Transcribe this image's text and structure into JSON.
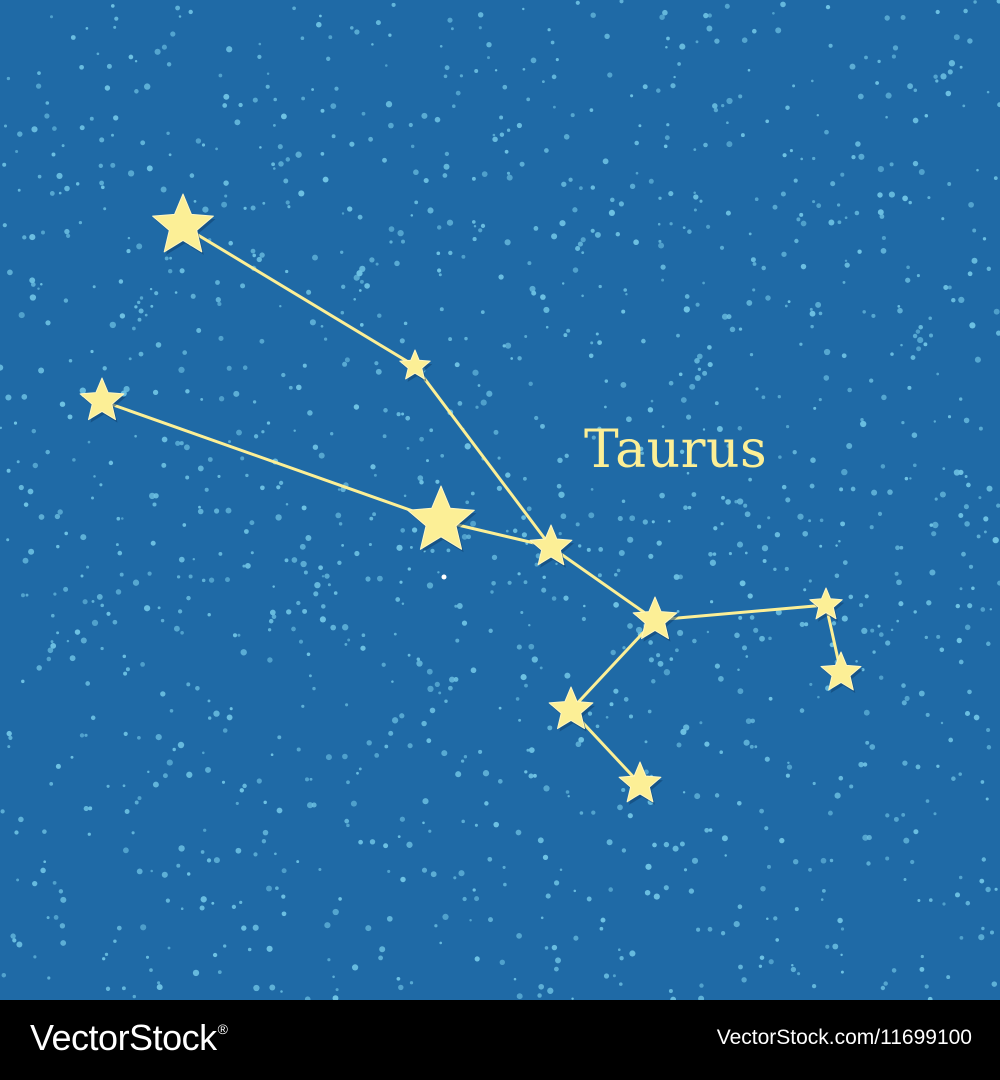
{
  "title": "Taurus",
  "colors": {
    "sky": "#1f6aa6",
    "dust": "#6ec2e3",
    "star": "#fcef96",
    "line": "#fcef96",
    "footer": "#000000"
  },
  "watermark": {
    "brand": "VectorStock",
    "registered_mark": "®",
    "image_ref": "VectorStock.com/11699100"
  }
}
